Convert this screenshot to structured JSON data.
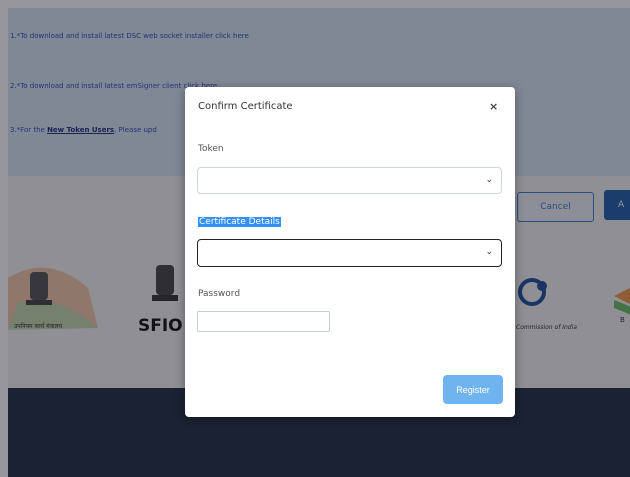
{
  "background": {
    "notes": [
      "1.*To download and install latest DSC web socket installer click here",
      "2.*To download and install latest emSigner client click here",
      "3.*For the "
    ],
    "note3_link": "New Token Users",
    "note3_suffix": ", Please upd",
    "cancel_label": "Cancel",
    "primary_label": "A",
    "logo_texts": {
      "sfio": "SFIO",
      "left_caption": "उपनियम कार्य मंत्रालय",
      "right_caption": "Commission of India",
      "far_right": "B"
    }
  },
  "modal": {
    "title": "Confirm Certificate",
    "close_symbol": "×",
    "token_label": "Token",
    "token_value": "",
    "cert_label": "Certificate Details",
    "cert_value": "",
    "password_label": "Password",
    "password_value": "",
    "register_label": "Register"
  },
  "colors": {
    "accent": "#6fb4ef",
    "selection": "#3390ff",
    "footer": "#1f2f44"
  }
}
